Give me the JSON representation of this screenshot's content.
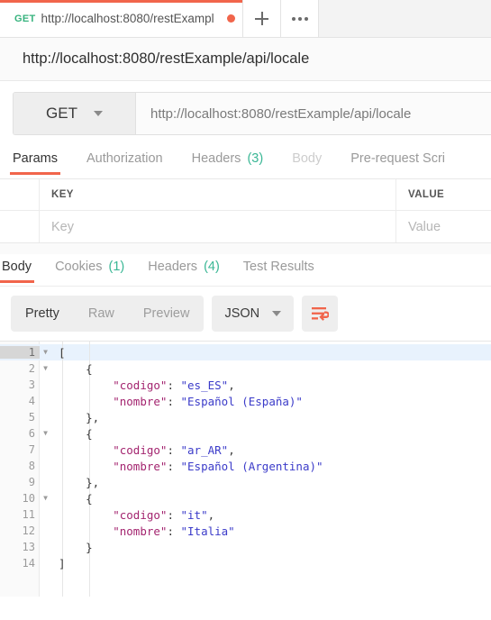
{
  "tabstrip": {
    "request_tab": {
      "method": "GET",
      "title": "http://localhost:8080/restExampl",
      "unsaved_indicator": "unsaved-dot"
    },
    "new_tab_label": "+",
    "more_label": "•••"
  },
  "url_heading": "http://localhost:8080/restExample/api/locale",
  "request_bar": {
    "method": "GET",
    "url_value": "http://localhost:8080/restExample/api/locale"
  },
  "request_tabs": [
    {
      "label": "Params",
      "count": "",
      "active": true,
      "disabled": false
    },
    {
      "label": "Authorization",
      "count": "",
      "active": false,
      "disabled": false
    },
    {
      "label": "Headers",
      "count": "(3)",
      "active": false,
      "disabled": false
    },
    {
      "label": "Body",
      "count": "",
      "active": false,
      "disabled": true
    },
    {
      "label": "Pre-request Scri",
      "count": "",
      "active": false,
      "disabled": false
    }
  ],
  "params_table": {
    "headers": {
      "key": "KEY",
      "value": "VALUE"
    },
    "row": {
      "key_placeholder": "Key",
      "value_placeholder": "Value"
    }
  },
  "response_tabs": [
    {
      "label": "Body",
      "count": "",
      "active": true,
      "disabled": false
    },
    {
      "label": "Cookies",
      "count": "(1)",
      "active": false,
      "disabled": false
    },
    {
      "label": "Headers",
      "count": "(4)",
      "active": false,
      "disabled": false
    },
    {
      "label": "Test Results",
      "count": "",
      "active": false,
      "disabled": false
    }
  ],
  "format_bar": {
    "views": [
      {
        "label": "Pretty",
        "active": true
      },
      {
        "label": "Raw",
        "active": false
      },
      {
        "label": "Preview",
        "active": false
      }
    ],
    "language": "JSON",
    "wrap_icon": "word-wrap-icon"
  },
  "response_body": {
    "language": "json",
    "active_line": 1,
    "colors": {
      "key": "#a3246f",
      "string": "#3b3bc9",
      "punctuation": "#3a3a3a",
      "active_line_bg": "#e8f2fd"
    },
    "lines": [
      {
        "n": 1,
        "fold": true,
        "indent": 0,
        "tokens": [
          {
            "t": "[",
            "c": "pun"
          }
        ]
      },
      {
        "n": 2,
        "fold": true,
        "indent": 1,
        "tokens": [
          {
            "t": "{",
            "c": "pun"
          }
        ]
      },
      {
        "n": 3,
        "fold": false,
        "indent": 2,
        "tokens": [
          {
            "t": "\"codigo\"",
            "c": "key"
          },
          {
            "t": ": ",
            "c": "pun"
          },
          {
            "t": "\"es_ES\"",
            "c": "str"
          },
          {
            "t": ",",
            "c": "pun"
          }
        ]
      },
      {
        "n": 4,
        "fold": false,
        "indent": 2,
        "tokens": [
          {
            "t": "\"nombre\"",
            "c": "key"
          },
          {
            "t": ": ",
            "c": "pun"
          },
          {
            "t": "\"Español (España)\"",
            "c": "str"
          }
        ]
      },
      {
        "n": 5,
        "fold": false,
        "indent": 1,
        "tokens": [
          {
            "t": "},",
            "c": "pun"
          }
        ]
      },
      {
        "n": 6,
        "fold": true,
        "indent": 1,
        "tokens": [
          {
            "t": "{",
            "c": "pun"
          }
        ]
      },
      {
        "n": 7,
        "fold": false,
        "indent": 2,
        "tokens": [
          {
            "t": "\"codigo\"",
            "c": "key"
          },
          {
            "t": ": ",
            "c": "pun"
          },
          {
            "t": "\"ar_AR\"",
            "c": "str"
          },
          {
            "t": ",",
            "c": "pun"
          }
        ]
      },
      {
        "n": 8,
        "fold": false,
        "indent": 2,
        "tokens": [
          {
            "t": "\"nombre\"",
            "c": "key"
          },
          {
            "t": ": ",
            "c": "pun"
          },
          {
            "t": "\"Español (Argentina)\"",
            "c": "str"
          }
        ]
      },
      {
        "n": 9,
        "fold": false,
        "indent": 1,
        "tokens": [
          {
            "t": "},",
            "c": "pun"
          }
        ]
      },
      {
        "n": 10,
        "fold": true,
        "indent": 1,
        "tokens": [
          {
            "t": "{",
            "c": "pun"
          }
        ]
      },
      {
        "n": 11,
        "fold": false,
        "indent": 2,
        "tokens": [
          {
            "t": "\"codigo\"",
            "c": "key"
          },
          {
            "t": ": ",
            "c": "pun"
          },
          {
            "t": "\"it\"",
            "c": "str"
          },
          {
            "t": ",",
            "c": "pun"
          }
        ]
      },
      {
        "n": 12,
        "fold": false,
        "indent": 2,
        "tokens": [
          {
            "t": "\"nombre\"",
            "c": "key"
          },
          {
            "t": ": ",
            "c": "pun"
          },
          {
            "t": "\"Italia\"",
            "c": "str"
          }
        ]
      },
      {
        "n": 13,
        "fold": false,
        "indent": 1,
        "tokens": [
          {
            "t": "}",
            "c": "pun"
          }
        ]
      },
      {
        "n": 14,
        "fold": false,
        "indent": 0,
        "tokens": [
          {
            "t": "]",
            "c": "pun"
          }
        ]
      }
    ],
    "parsed": [
      {
        "codigo": "es_ES",
        "nombre": "Español (España)"
      },
      {
        "codigo": "ar_AR",
        "nombre": "Español (Argentina)"
      },
      {
        "codigo": "it",
        "nombre": "Italia"
      }
    ]
  },
  "theme": {
    "accent": "#f1654b",
    "method_get": "#37b37e",
    "count_badge": "#3ab795"
  }
}
